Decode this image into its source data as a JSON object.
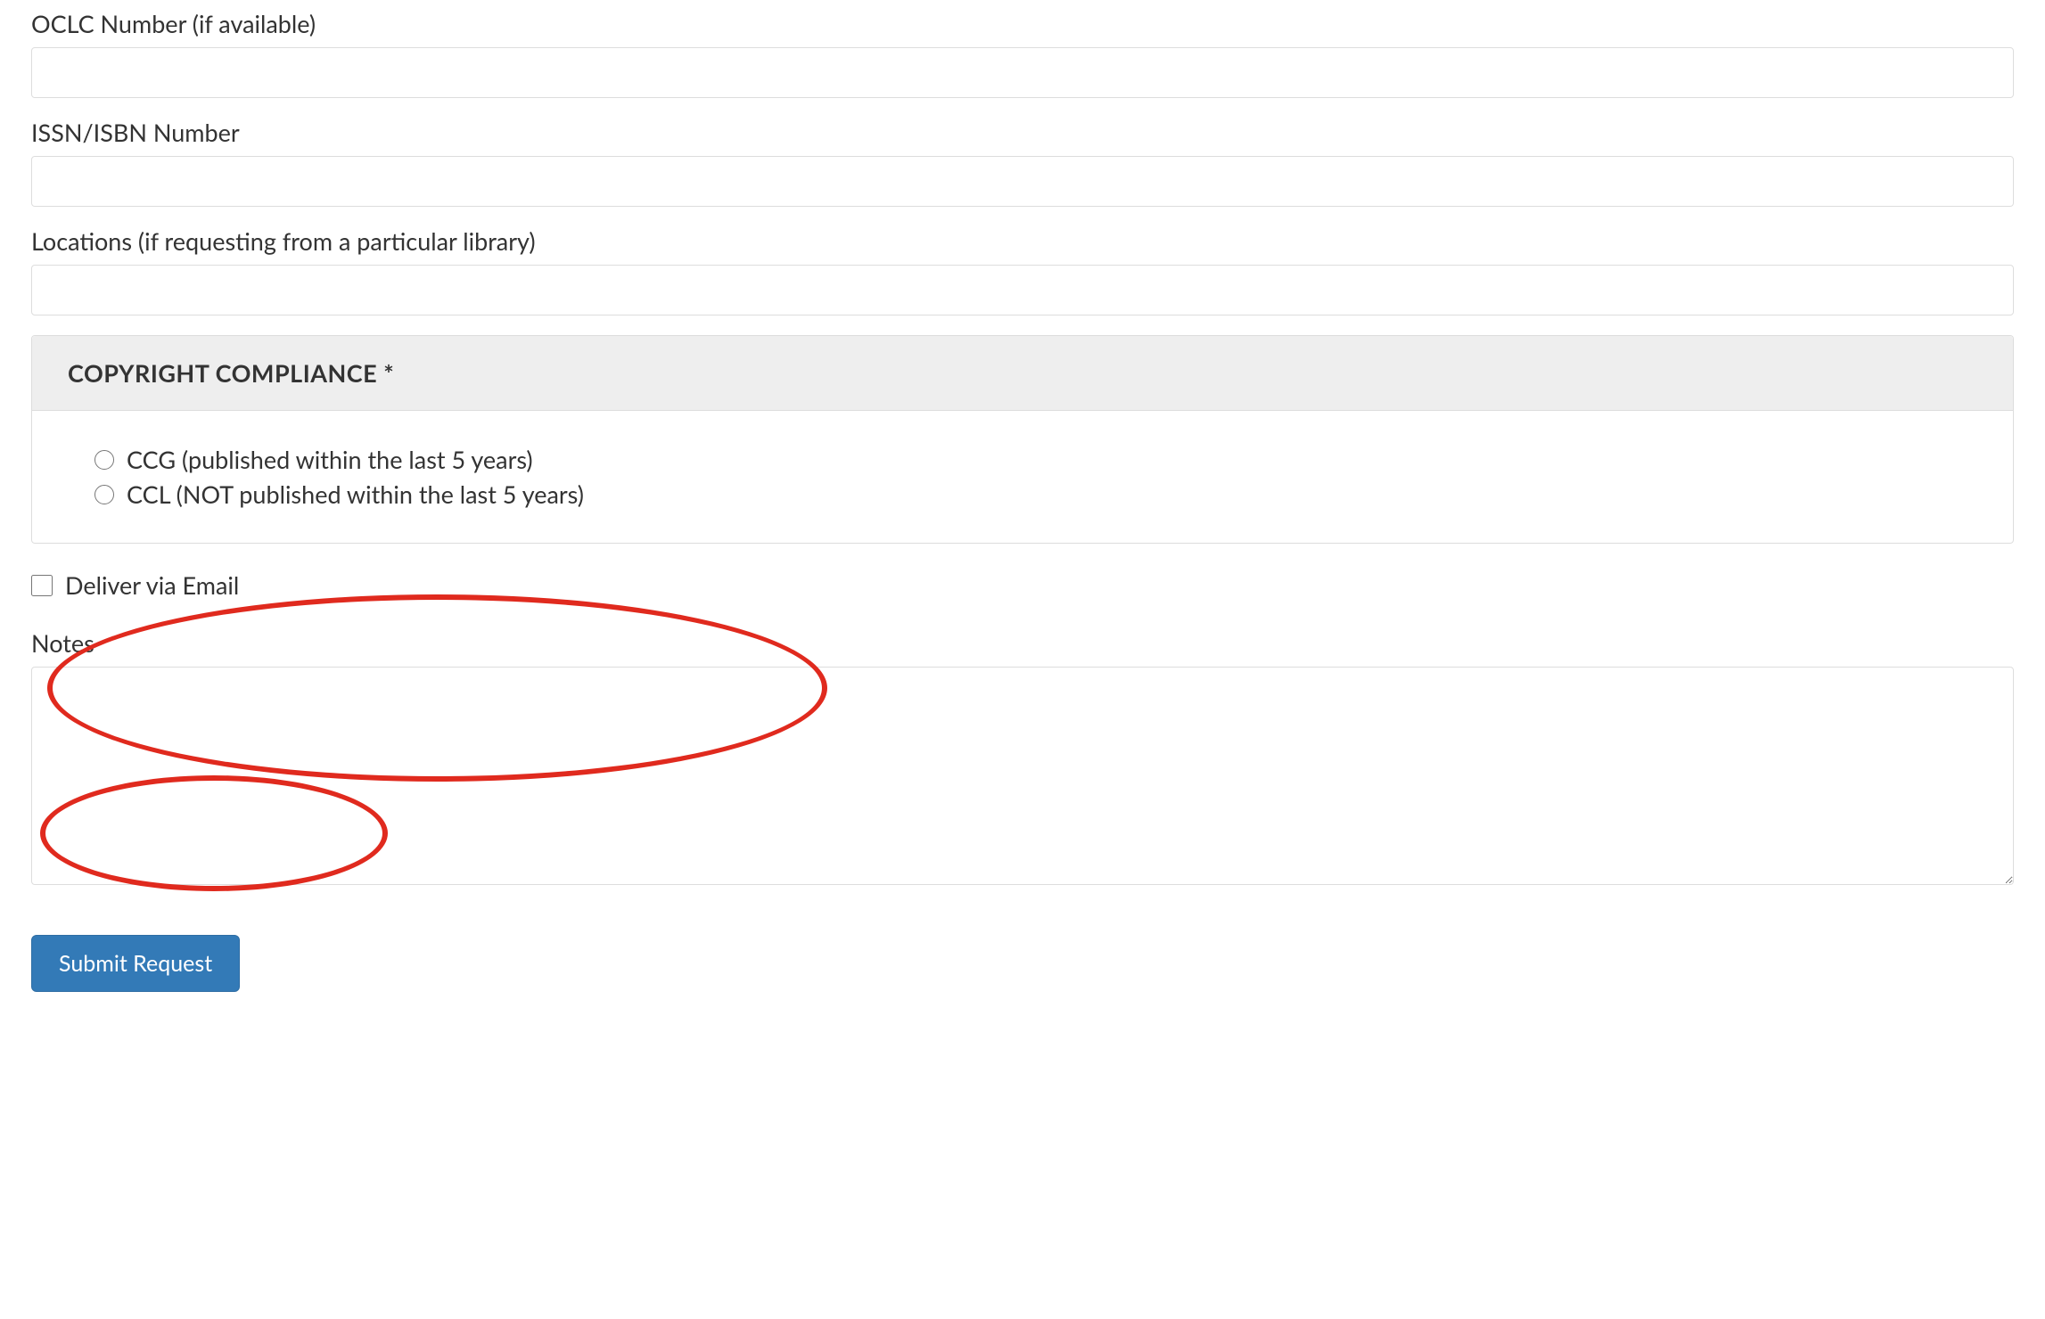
{
  "fields": {
    "oclc": {
      "label": "OCLC Number (if available)",
      "value": ""
    },
    "issn_isbn": {
      "label": "ISSN/ISBN Number",
      "value": ""
    },
    "locations": {
      "label": "Locations (if requesting from a particular library)",
      "value": ""
    },
    "notes": {
      "label": "Notes",
      "value": ""
    }
  },
  "copyright_panel": {
    "header": "COPYRIGHT COMPLIANCE *",
    "options": [
      {
        "label": "CCG (published within the last 5 years)",
        "value": "CCG",
        "checked": false
      },
      {
        "label": "CCL (NOT published within the last 5 years)",
        "value": "CCL",
        "checked": false
      }
    ]
  },
  "deliver_email": {
    "label": "Deliver via Email",
    "checked": false
  },
  "submit": {
    "label": "Submit Request"
  }
}
